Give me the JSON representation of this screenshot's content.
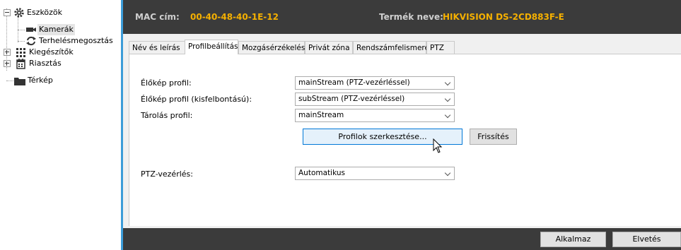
{
  "tree": {
    "items": [
      {
        "label": "Eszközök",
        "icon": "gear-icon"
      },
      {
        "label": "Kamerák",
        "icon": "camera-icon"
      },
      {
        "label": "Terhelésmegosztás",
        "icon": "load-balance-icon"
      },
      {
        "label": "Kiegészítők",
        "icon": "plugin-grid-icon"
      },
      {
        "label": "Riasztás",
        "icon": "alarm-calendar-icon"
      },
      {
        "label": "Térkép",
        "icon": "folder-map-icon"
      }
    ]
  },
  "header": {
    "mac_label": "MAC cím:",
    "mac_value": "00-40-48-40-1E-12",
    "product_label": "Termék neve:",
    "product_value": "HIKVISION DS-2CD883F-E"
  },
  "tabs": [
    {
      "label": "Név és leírás",
      "active": false
    },
    {
      "label": "Profilbeállítás",
      "active": true
    },
    {
      "label": "Mozgásérzékelés",
      "active": false
    },
    {
      "label": "Privát zóna",
      "active": false
    },
    {
      "label": "Rendszámfelismerés",
      "active": false
    },
    {
      "label": "PTZ",
      "active": false
    }
  ],
  "profiles": {
    "live_label": "Élőkép profil:",
    "live_value": "mainStream (PTZ-vezérléssel)",
    "live_low_label": "Élőkép profil (kisfelbontású):",
    "live_low_value": "subStream (PTZ-vezérléssel)",
    "storage_label": "Tárolás profil:",
    "storage_value": "mainStream",
    "edit_button": "Profilok szerkesztése...",
    "refresh_button": "Frissítés",
    "ptz_label": "PTZ-vezérlés:",
    "ptz_value": "Automatikus"
  },
  "footer": {
    "apply_button": "Alkalmaz",
    "discard_button": "Elvetés"
  },
  "colors": {
    "accent_blue": "#3c9cd8",
    "header_bg": "#3b3b3b",
    "header_value": "#f5b000"
  }
}
